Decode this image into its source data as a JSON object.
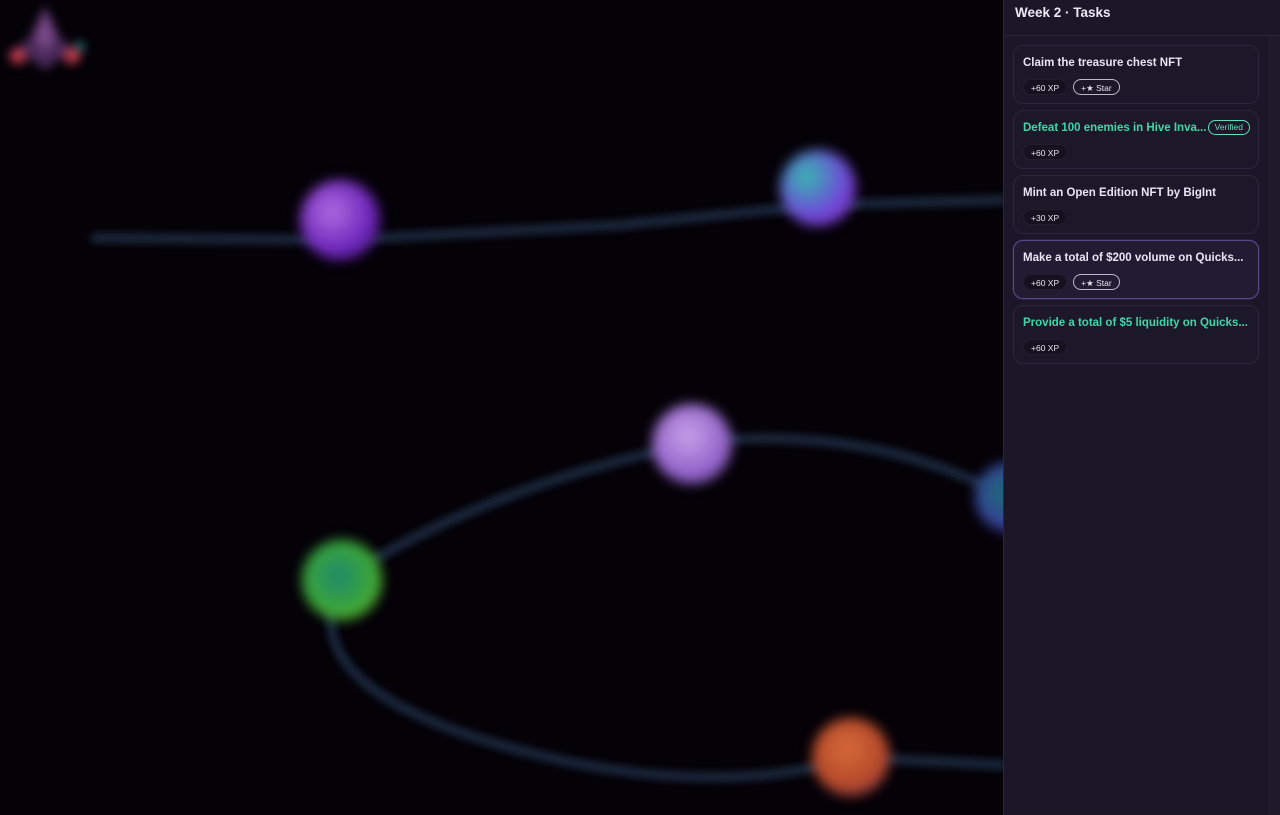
{
  "panel": {
    "title": "Week 2 · Tasks"
  },
  "tasks": [
    {
      "title": "Claim the treasure chest NFT",
      "xp": "+60 XP",
      "star": "+★ Star",
      "status": "open"
    },
    {
      "title": "Defeat 100 enemies in Hive Inva...",
      "xp": "+60 XP",
      "verified": "Verified",
      "status": "verified"
    },
    {
      "title": "Mint an Open Edition NFT by BigInt",
      "xp": "+30 XP",
      "status": "open"
    },
    {
      "title": "Make a total of $200 volume on Quicks...",
      "xp": "+60 XP",
      "star": "+★ Star",
      "status": "selected"
    },
    {
      "title": "Provide a total of $5 liquidity on Quicks...",
      "xp": "+60 XP",
      "status": "completed"
    }
  ],
  "colors": {
    "background": "#040107",
    "panel": "#1b1628",
    "completed_text": "#3fd6a8",
    "selected_border": "#5a4a8c"
  },
  "map": {
    "node_icons": [
      "purple-orb-icon",
      "teal-purple-orb-icon",
      "lavender-orb-icon",
      "green-orb-icon",
      "orange-orb-icon",
      "teal-blue-orb-icon",
      "spaceship-icon"
    ]
  }
}
